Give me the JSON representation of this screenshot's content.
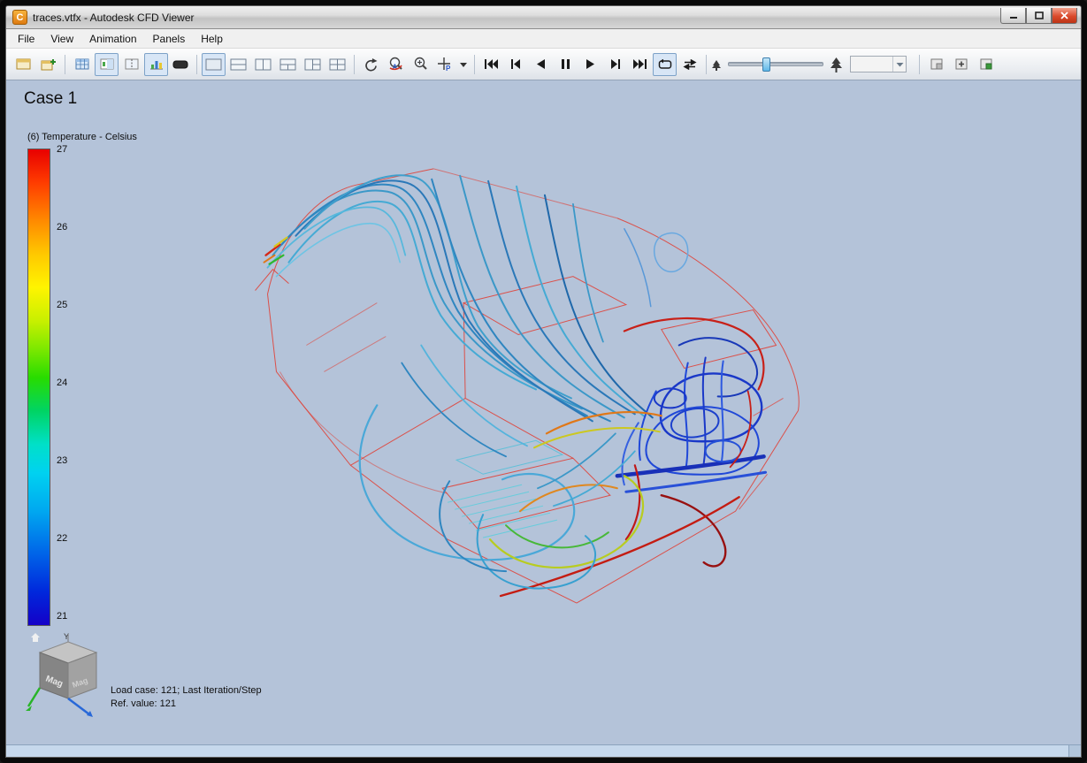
{
  "window": {
    "title": "traces.vtfx - Autodesk CFD Viewer",
    "app_icon_letter": "C"
  },
  "menu": {
    "items": [
      {
        "label": "File"
      },
      {
        "label": "View"
      },
      {
        "label": "Animation"
      },
      {
        "label": "Panels"
      },
      {
        "label": "Help"
      }
    ]
  },
  "toolbar": {
    "button_names": [
      "open-layout",
      "add-layout",
      "table-view",
      "plot-panel",
      "split-table",
      "column-chart",
      "blank-screen",
      "layout-single",
      "layout-horizontal-split",
      "layout-vertical-split",
      "layout-bottom-split",
      "layout-right-split",
      "layout-quad",
      "rotate-view",
      "zoom-area",
      "zoom-in",
      "probe-point",
      "probe-options",
      "first-frame",
      "previous-frame",
      "play-backward",
      "pause",
      "play-forward",
      "next-frame",
      "last-frame",
      "loop-playback",
      "bounce-playback",
      "speed-slow",
      "speed-slider",
      "speed-fast",
      "frame-select",
      "snapshot",
      "add-view",
      "export-view"
    ],
    "icon_letters": {
      "zoom_area": "A",
      "probe": "P"
    },
    "frame_select_value": ""
  },
  "viewport": {
    "case_title": "Case 1",
    "legend": {
      "title": "(6) Temperature - Celsius",
      "scalar": "Temperature",
      "units": "Celsius",
      "max": 27,
      "min": 21,
      "ticks": [
        "27",
        "26",
        "25",
        "24",
        "23",
        "22",
        "21"
      ],
      "top_color": "#e80000",
      "bottom_color": "#1400c8"
    },
    "status": {
      "line1": "Load case: 121; Last Iteration/Step",
      "line2": "Ref. value: 121"
    },
    "orientation_cube": {
      "face_label": "Mag",
      "axis_top_label": "Y"
    }
  }
}
